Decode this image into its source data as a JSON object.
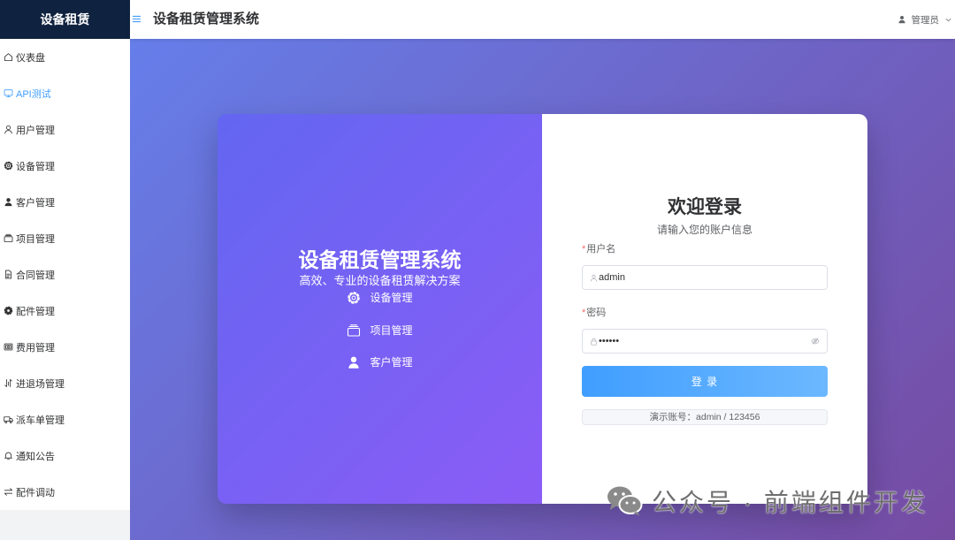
{
  "colors": {
    "brand_bg": "#0f2340",
    "accent": "#409eff",
    "text_primary": "#303133",
    "text_regular": "#606266",
    "required": "#f56c6c",
    "main_gradient": [
      "#667eea",
      "#764ba2"
    ],
    "panel_gradient": [
      "#6366f1",
      "#8b5cf6"
    ],
    "button_gradient": [
      "#409eff",
      "#6cb8ff"
    ]
  },
  "sidebar": {
    "brand": "设备租赁",
    "items": [
      {
        "label": "仪表盘",
        "icon": "home-icon"
      },
      {
        "label": "API测试",
        "icon": "monitor-icon",
        "active": true
      },
      {
        "label": "用户管理",
        "icon": "user-icon"
      },
      {
        "label": "设备管理",
        "icon": "gear-icon"
      },
      {
        "label": "客户管理",
        "icon": "user-filled-icon"
      },
      {
        "label": "项目管理",
        "icon": "folder-stack-icon"
      },
      {
        "label": "合同管理",
        "icon": "document-icon"
      },
      {
        "label": "配件管理",
        "icon": "gear-filled-icon"
      },
      {
        "label": "费用管理",
        "icon": "money-icon"
      },
      {
        "label": "进退场管理",
        "icon": "sort-icon"
      },
      {
        "label": "派车单管理",
        "icon": "truck-icon"
      },
      {
        "label": "通知公告",
        "icon": "bell-icon"
      },
      {
        "label": "配件调动",
        "icon": "switch-icon"
      }
    ]
  },
  "header": {
    "menu_icon": "hamburger-icon",
    "title": "设备租赁管理系统",
    "user": {
      "icon": "user-filled-icon",
      "name": "管理员",
      "dropdown_icon": "chevron-down-icon"
    }
  },
  "login": {
    "intro": {
      "title": "设备租赁管理系统",
      "subtitle": "高效、专业的设备租赁解决方案",
      "features": [
        {
          "label": "设备管理",
          "icon": "gear-icon"
        },
        {
          "label": "项目管理",
          "icon": "folder-stack-icon"
        },
        {
          "label": "客户管理",
          "icon": "user-filled-icon"
        }
      ]
    },
    "form": {
      "title": "欢迎登录",
      "subtitle": "请输入您的账户信息",
      "required_mark": "*",
      "username": {
        "label": "用户名",
        "value": "admin",
        "icon": "user-icon"
      },
      "password": {
        "label": "密码",
        "value": "••••••",
        "icon": "lock-icon",
        "toggle_icon": "eye-off-icon"
      },
      "submit_label": "登 录",
      "demo_hint": "演示账号：admin / 123456"
    }
  },
  "watermark": {
    "icon": "wechat-icon",
    "text": "公众号 · 前端组件开发"
  }
}
